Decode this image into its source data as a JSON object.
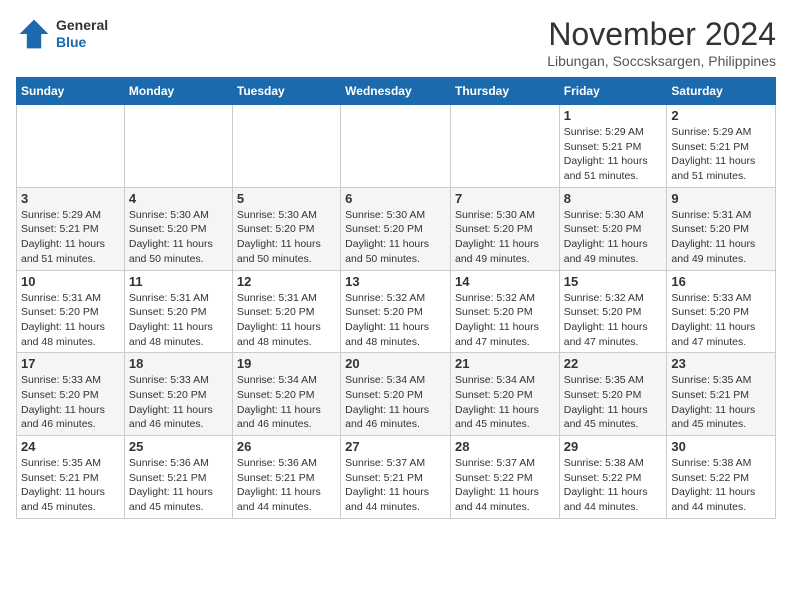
{
  "header": {
    "logo": {
      "general": "General",
      "blue": "Blue"
    },
    "title": "November 2024",
    "location": "Libungan, Soccsksargen, Philippines"
  },
  "weekdays": [
    "Sunday",
    "Monday",
    "Tuesday",
    "Wednesday",
    "Thursday",
    "Friday",
    "Saturday"
  ],
  "weeks": [
    [
      {
        "day": "",
        "sunrise": "",
        "sunset": "",
        "daylight": ""
      },
      {
        "day": "",
        "sunrise": "",
        "sunset": "",
        "daylight": ""
      },
      {
        "day": "",
        "sunrise": "",
        "sunset": "",
        "daylight": ""
      },
      {
        "day": "",
        "sunrise": "",
        "sunset": "",
        "daylight": ""
      },
      {
        "day": "",
        "sunrise": "",
        "sunset": "",
        "daylight": ""
      },
      {
        "day": "1",
        "sunrise": "Sunrise: 5:29 AM",
        "sunset": "Sunset: 5:21 PM",
        "daylight": "Daylight: 11 hours and 51 minutes."
      },
      {
        "day": "2",
        "sunrise": "Sunrise: 5:29 AM",
        "sunset": "Sunset: 5:21 PM",
        "daylight": "Daylight: 11 hours and 51 minutes."
      }
    ],
    [
      {
        "day": "3",
        "sunrise": "Sunrise: 5:29 AM",
        "sunset": "Sunset: 5:21 PM",
        "daylight": "Daylight: 11 hours and 51 minutes."
      },
      {
        "day": "4",
        "sunrise": "Sunrise: 5:30 AM",
        "sunset": "Sunset: 5:20 PM",
        "daylight": "Daylight: 11 hours and 50 minutes."
      },
      {
        "day": "5",
        "sunrise": "Sunrise: 5:30 AM",
        "sunset": "Sunset: 5:20 PM",
        "daylight": "Daylight: 11 hours and 50 minutes."
      },
      {
        "day": "6",
        "sunrise": "Sunrise: 5:30 AM",
        "sunset": "Sunset: 5:20 PM",
        "daylight": "Daylight: 11 hours and 50 minutes."
      },
      {
        "day": "7",
        "sunrise": "Sunrise: 5:30 AM",
        "sunset": "Sunset: 5:20 PM",
        "daylight": "Daylight: 11 hours and 49 minutes."
      },
      {
        "day": "8",
        "sunrise": "Sunrise: 5:30 AM",
        "sunset": "Sunset: 5:20 PM",
        "daylight": "Daylight: 11 hours and 49 minutes."
      },
      {
        "day": "9",
        "sunrise": "Sunrise: 5:31 AM",
        "sunset": "Sunset: 5:20 PM",
        "daylight": "Daylight: 11 hours and 49 minutes."
      }
    ],
    [
      {
        "day": "10",
        "sunrise": "Sunrise: 5:31 AM",
        "sunset": "Sunset: 5:20 PM",
        "daylight": "Daylight: 11 hours and 48 minutes."
      },
      {
        "day": "11",
        "sunrise": "Sunrise: 5:31 AM",
        "sunset": "Sunset: 5:20 PM",
        "daylight": "Daylight: 11 hours and 48 minutes."
      },
      {
        "day": "12",
        "sunrise": "Sunrise: 5:31 AM",
        "sunset": "Sunset: 5:20 PM",
        "daylight": "Daylight: 11 hours and 48 minutes."
      },
      {
        "day": "13",
        "sunrise": "Sunrise: 5:32 AM",
        "sunset": "Sunset: 5:20 PM",
        "daylight": "Daylight: 11 hours and 48 minutes."
      },
      {
        "day": "14",
        "sunrise": "Sunrise: 5:32 AM",
        "sunset": "Sunset: 5:20 PM",
        "daylight": "Daylight: 11 hours and 47 minutes."
      },
      {
        "day": "15",
        "sunrise": "Sunrise: 5:32 AM",
        "sunset": "Sunset: 5:20 PM",
        "daylight": "Daylight: 11 hours and 47 minutes."
      },
      {
        "day": "16",
        "sunrise": "Sunrise: 5:33 AM",
        "sunset": "Sunset: 5:20 PM",
        "daylight": "Daylight: 11 hours and 47 minutes."
      }
    ],
    [
      {
        "day": "17",
        "sunrise": "Sunrise: 5:33 AM",
        "sunset": "Sunset: 5:20 PM",
        "daylight": "Daylight: 11 hours and 46 minutes."
      },
      {
        "day": "18",
        "sunrise": "Sunrise: 5:33 AM",
        "sunset": "Sunset: 5:20 PM",
        "daylight": "Daylight: 11 hours and 46 minutes."
      },
      {
        "day": "19",
        "sunrise": "Sunrise: 5:34 AM",
        "sunset": "Sunset: 5:20 PM",
        "daylight": "Daylight: 11 hours and 46 minutes."
      },
      {
        "day": "20",
        "sunrise": "Sunrise: 5:34 AM",
        "sunset": "Sunset: 5:20 PM",
        "daylight": "Daylight: 11 hours and 46 minutes."
      },
      {
        "day": "21",
        "sunrise": "Sunrise: 5:34 AM",
        "sunset": "Sunset: 5:20 PM",
        "daylight": "Daylight: 11 hours and 45 minutes."
      },
      {
        "day": "22",
        "sunrise": "Sunrise: 5:35 AM",
        "sunset": "Sunset: 5:20 PM",
        "daylight": "Daylight: 11 hours and 45 minutes."
      },
      {
        "day": "23",
        "sunrise": "Sunrise: 5:35 AM",
        "sunset": "Sunset: 5:21 PM",
        "daylight": "Daylight: 11 hours and 45 minutes."
      }
    ],
    [
      {
        "day": "24",
        "sunrise": "Sunrise: 5:35 AM",
        "sunset": "Sunset: 5:21 PM",
        "daylight": "Daylight: 11 hours and 45 minutes."
      },
      {
        "day": "25",
        "sunrise": "Sunrise: 5:36 AM",
        "sunset": "Sunset: 5:21 PM",
        "daylight": "Daylight: 11 hours and 45 minutes."
      },
      {
        "day": "26",
        "sunrise": "Sunrise: 5:36 AM",
        "sunset": "Sunset: 5:21 PM",
        "daylight": "Daylight: 11 hours and 44 minutes."
      },
      {
        "day": "27",
        "sunrise": "Sunrise: 5:37 AM",
        "sunset": "Sunset: 5:21 PM",
        "daylight": "Daylight: 11 hours and 44 minutes."
      },
      {
        "day": "28",
        "sunrise": "Sunrise: 5:37 AM",
        "sunset": "Sunset: 5:22 PM",
        "daylight": "Daylight: 11 hours and 44 minutes."
      },
      {
        "day": "29",
        "sunrise": "Sunrise: 5:38 AM",
        "sunset": "Sunset: 5:22 PM",
        "daylight": "Daylight: 11 hours and 44 minutes."
      },
      {
        "day": "30",
        "sunrise": "Sunrise: 5:38 AM",
        "sunset": "Sunset: 5:22 PM",
        "daylight": "Daylight: 11 hours and 44 minutes."
      }
    ]
  ]
}
